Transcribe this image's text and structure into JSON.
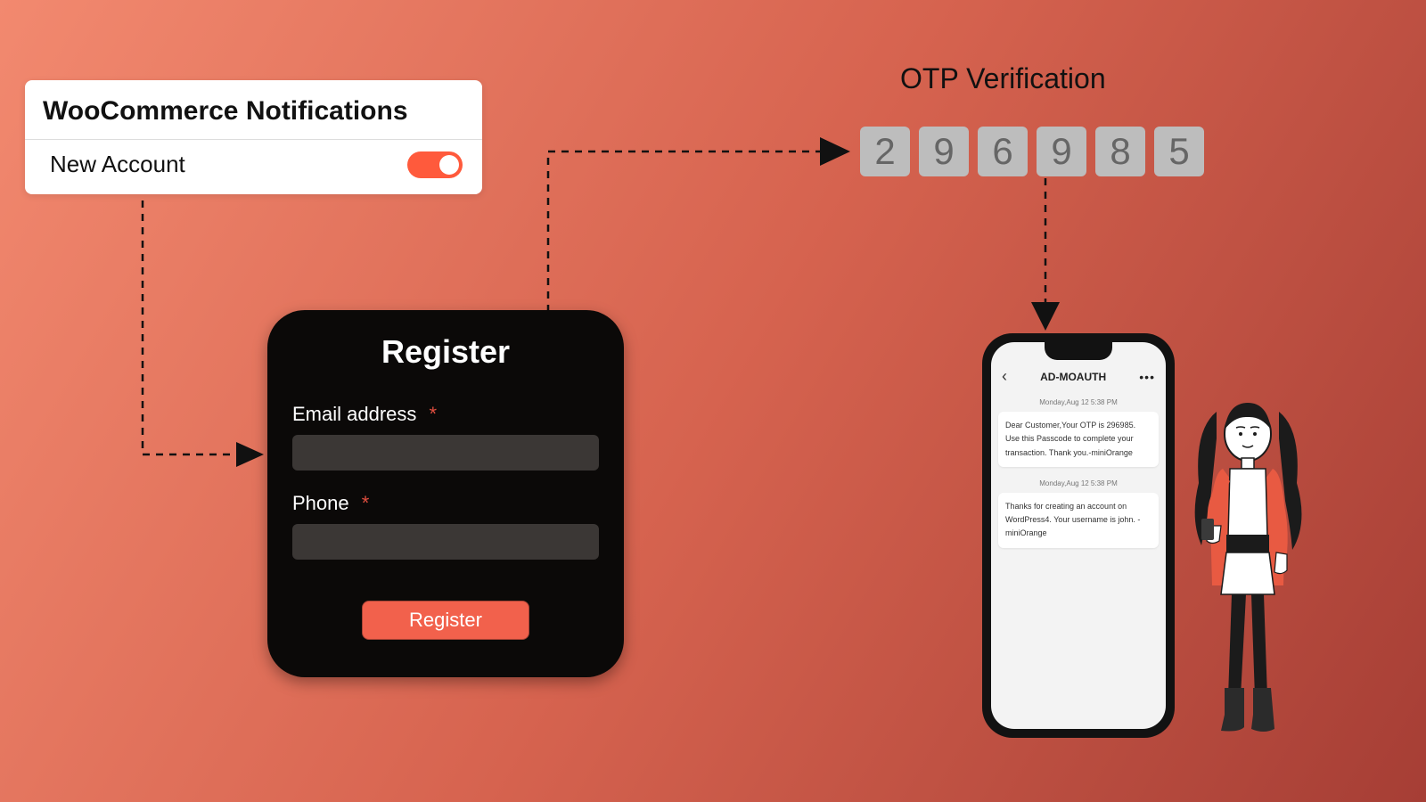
{
  "notifications": {
    "title": "WooCommerce Notifications",
    "row_label": "New Account",
    "toggle_on": true
  },
  "register": {
    "title": "Register",
    "email_label": "Email address",
    "phone_label": "Phone",
    "required": "*",
    "button": "Register"
  },
  "otp": {
    "title": "OTP Verification",
    "digits": [
      "2",
      "9",
      "6",
      "9",
      "8",
      "5"
    ]
  },
  "phone": {
    "sender": "AD-MOAUTH",
    "time1": "Monday,Aug 12 5:38 PM",
    "msg1": "Dear Customer,Your OTP is 296985. Use this Passcode to complete your transaction. Thank you.-miniOrange",
    "time2": "Monday,Aug 12 5:38 PM",
    "msg2": "Thanks for creating an account on WordPress4. Your username is john. -miniOrange"
  }
}
